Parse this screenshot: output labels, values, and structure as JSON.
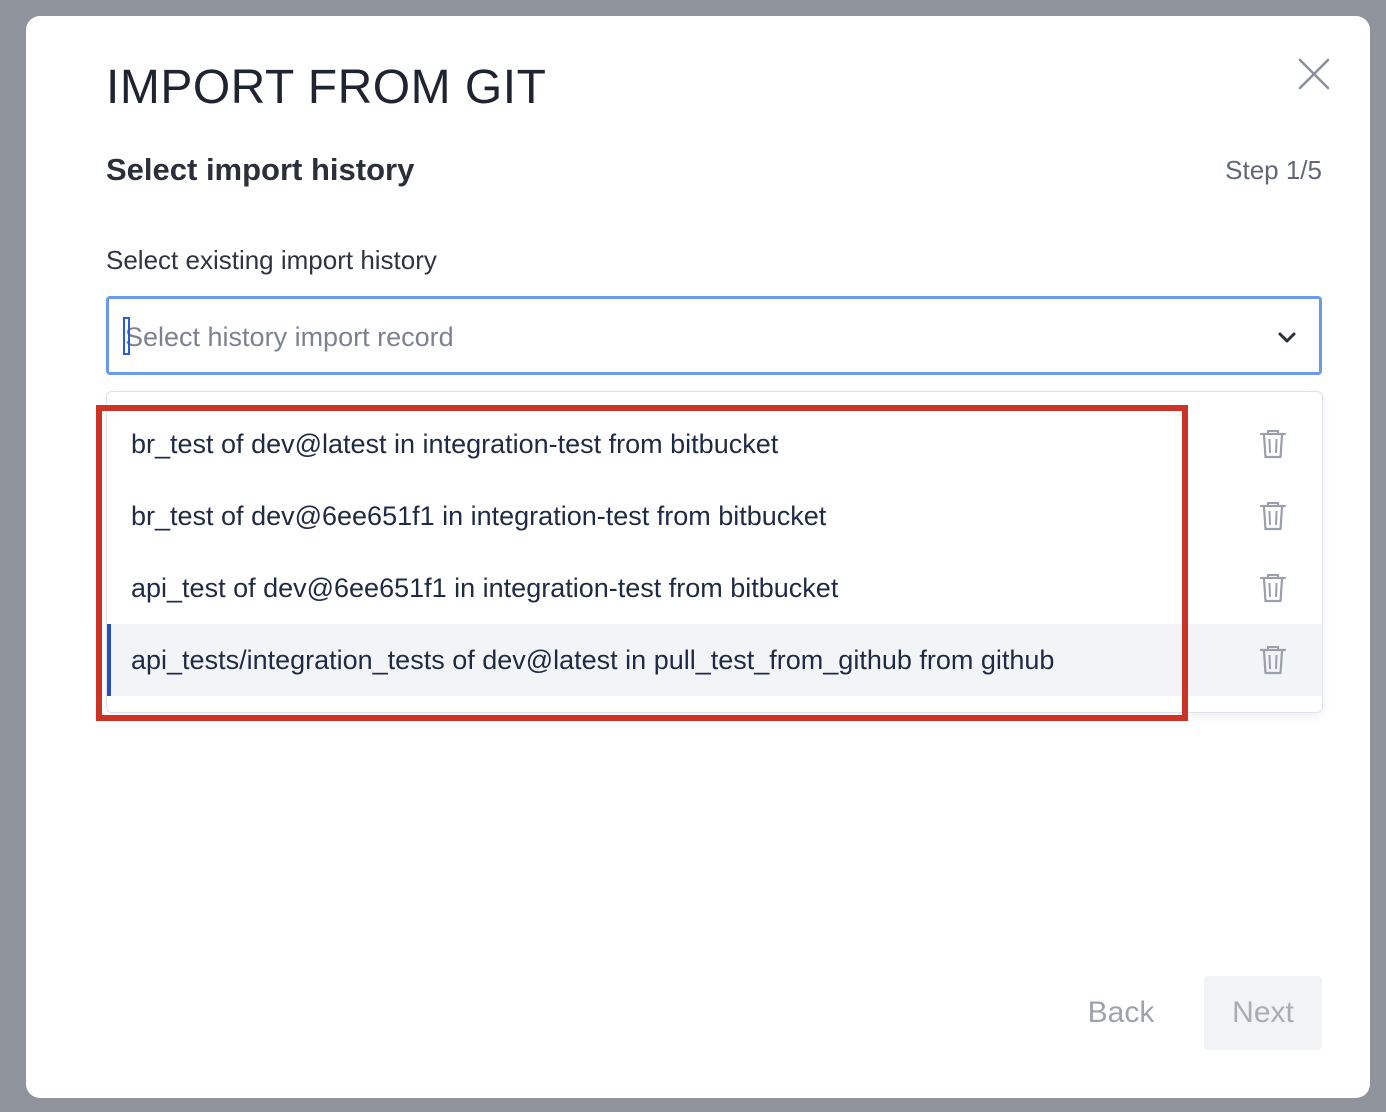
{
  "modal": {
    "title": "IMPORT FROM GIT",
    "subtitle": "Select import history",
    "step": "Step 1/5"
  },
  "field": {
    "label": "Select existing import history",
    "placeholder": "Select history import record"
  },
  "options": [
    {
      "label": "br_test of dev@latest in integration-test from bitbucket"
    },
    {
      "label": "br_test of dev@6ee651f1 in integration-test from bitbucket"
    },
    {
      "label": "api_test of dev@6ee651f1 in integration-test from bitbucket"
    },
    {
      "label": "api_tests/integration_tests of dev@latest in pull_test_from_github from github"
    }
  ],
  "footer": {
    "back_label": "Back",
    "next_label": "Next"
  },
  "icons": {
    "close": "close-icon",
    "chevron": "chevron-down-icon",
    "delete": "trash-icon"
  },
  "colors": {
    "focus_border": "#6b9be8",
    "highlight_annotation": "#cc3327",
    "active_option_bar": "#2a4fb8"
  }
}
